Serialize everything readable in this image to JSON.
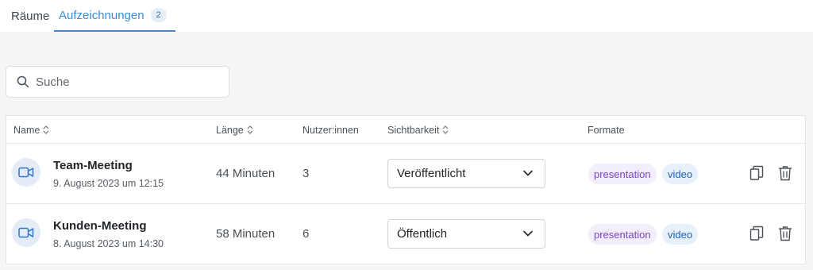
{
  "tabs": {
    "rooms": "Räume",
    "recordings": "Aufzeichnungen",
    "recordings_count": "2"
  },
  "search": {
    "placeholder": "Suche",
    "value": ""
  },
  "table": {
    "columns": {
      "name": "Name",
      "length": "Länge",
      "users": "Nutzer:innen",
      "visibility": "Sichtbarkeit",
      "formats": "Formate"
    },
    "rows": [
      {
        "name": "Team-Meeting",
        "date": "9. August 2023 um 12:15",
        "length": "44 Minuten",
        "users": "3",
        "visibility": "Veröffentlicht",
        "formats": [
          "presentation",
          "video"
        ]
      },
      {
        "name": "Kunden-Meeting",
        "date": "8. August 2023 um 14:30",
        "length": "58 Minuten",
        "users": "6",
        "visibility": "Öffentlich",
        "formats": [
          "presentation",
          "video"
        ]
      }
    ]
  },
  "icons": {
    "search": "search-icon",
    "sort": "sort-icon",
    "recording": "video-camera-icon",
    "dropdown": "chevron-down-icon",
    "copy": "copy-icon",
    "delete": "trash-icon"
  },
  "colors": {
    "accent": "#3b8bd9",
    "presentation_badge": "#7a44c4",
    "video_badge": "#1b62c2"
  }
}
